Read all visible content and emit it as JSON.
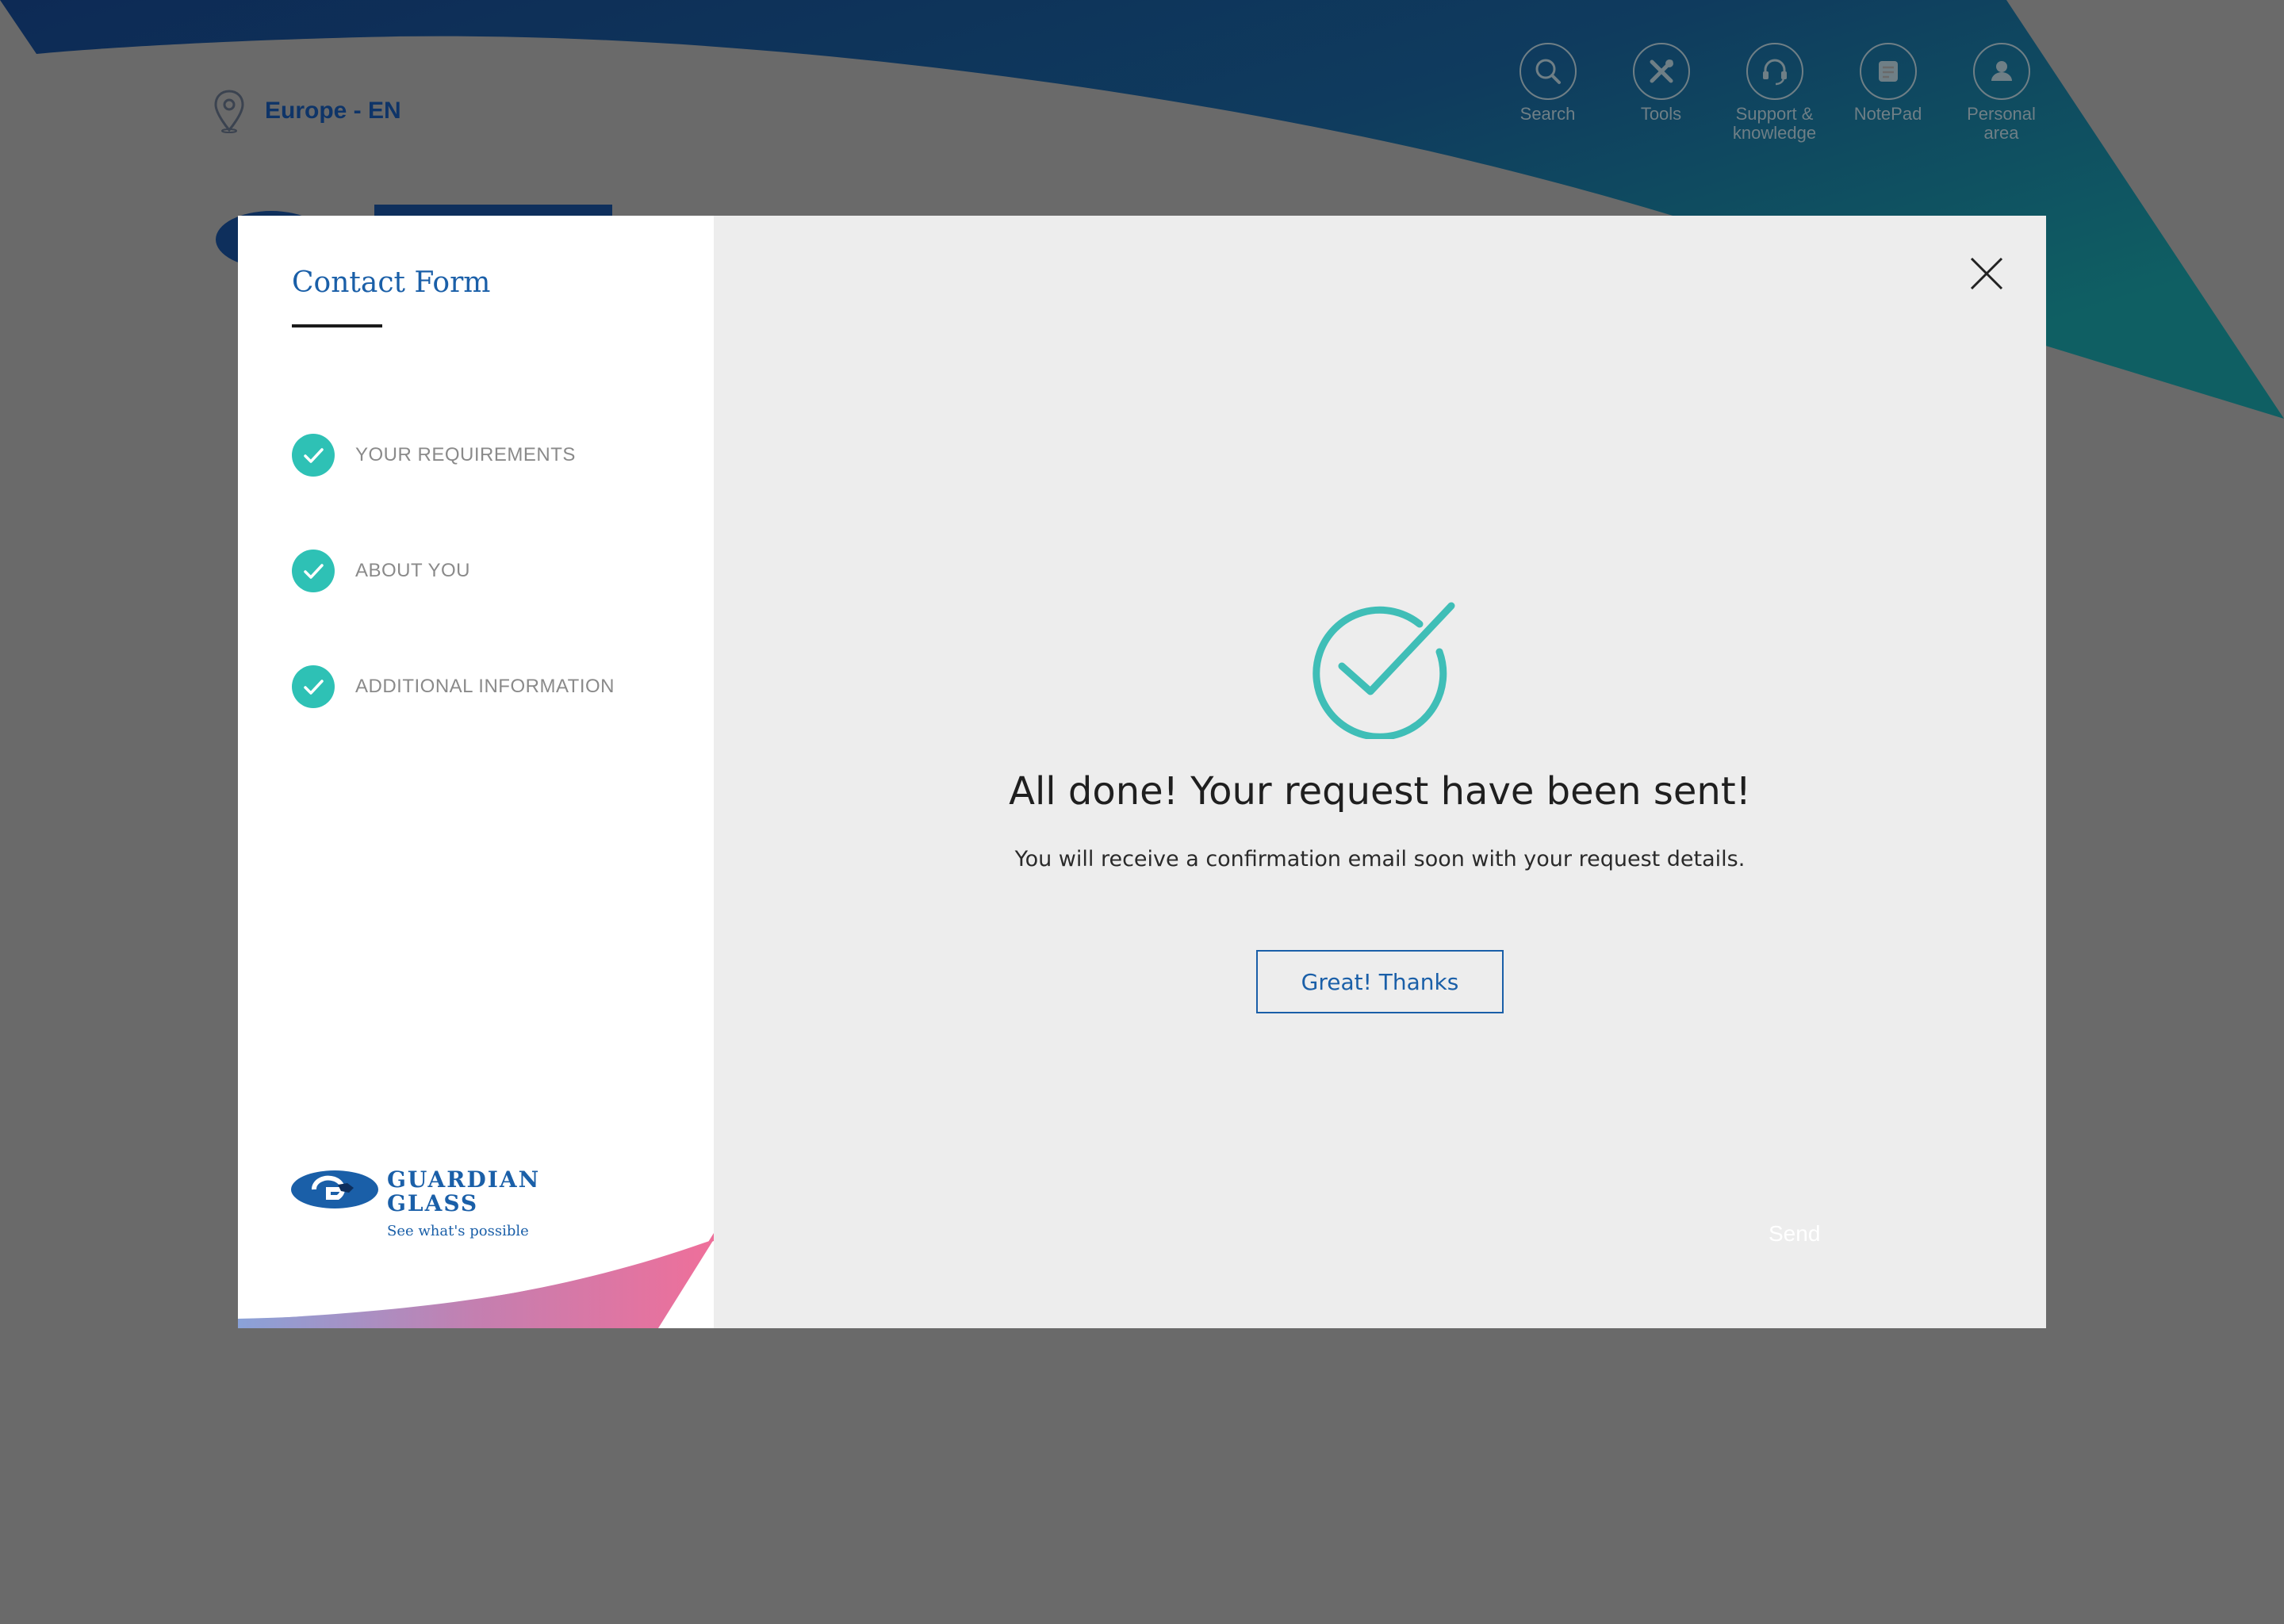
{
  "header": {
    "locale": "Europe - EN",
    "nav": [
      {
        "label": "Search",
        "icon": "search-icon"
      },
      {
        "label": "Tools",
        "icon": "tools-icon"
      },
      {
        "label": "Support &\nknowledge",
        "icon": "headset-icon"
      },
      {
        "label": "NotePad",
        "icon": "notepad-icon"
      },
      {
        "label": "Personal\narea",
        "icon": "user-icon"
      }
    ]
  },
  "modal": {
    "title": "Contact Form",
    "steps": [
      {
        "label": "YOUR REQUIREMENTS",
        "status": "done"
      },
      {
        "label": "ABOUT YOU",
        "status": "done"
      },
      {
        "label": "ADDITIONAL INFORMATION",
        "status": "done"
      }
    ],
    "logo": {
      "line1": "GUARDIAN",
      "line2": "GLASS",
      "tagline": "See what's possible"
    },
    "success": {
      "headline": "All done! Your request have been sent!",
      "message": "You will receive a confirmation email soon with your request details.",
      "button": "Great! Thanks"
    },
    "send_label": "Send"
  },
  "colors": {
    "accent_blue": "#1a5fa8",
    "teal": "#2ec1b5",
    "backdrop": "#6a6a6a",
    "panel": "#ededed"
  }
}
